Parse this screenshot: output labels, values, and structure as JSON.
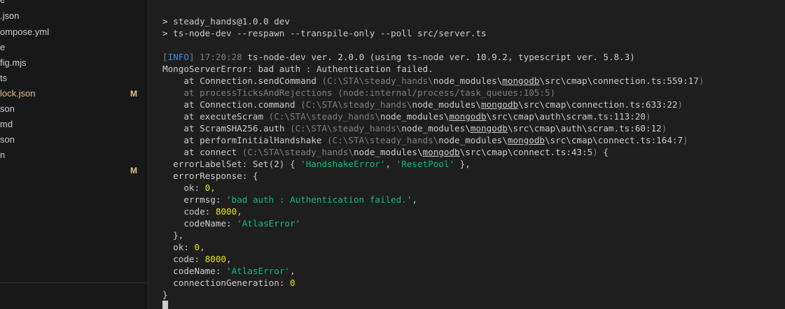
{
  "sidebar": {
    "files": [
      {
        "name": "e",
        "badge": ""
      },
      {
        "name": ".json",
        "badge": ""
      },
      {
        "name": "ompose.yml",
        "badge": ""
      },
      {
        "name": "e",
        "badge": ""
      },
      {
        "name": "fig.mjs",
        "badge": ""
      },
      {
        "name": "ts",
        "badge": ""
      },
      {
        "name": "lock.json",
        "badge": "M"
      },
      {
        "name": "son",
        "badge": ""
      },
      {
        "name": "md",
        "badge": ""
      },
      {
        "name": "son",
        "badge": ""
      },
      {
        "name": "n",
        "badge": ""
      },
      {
        "name": "",
        "badge": "M"
      }
    ]
  },
  "terminal": {
    "lines": [
      {
        "segments": [
          {
            "t": "> steady_hands@1.0.0 dev"
          }
        ]
      },
      {
        "segments": [
          {
            "t": "> ts-node-dev --respawn --transpile-only --poll src/server.ts"
          }
        ]
      },
      {
        "segments": []
      },
      {
        "segments": [
          {
            "t": "[",
            "c": "c-gray"
          },
          {
            "t": "INFO",
            "c": "c-cyan"
          },
          {
            "t": "] ",
            "c": "c-gray"
          },
          {
            "t": "17:20:28",
            "c": "c-gray"
          },
          {
            "t": " ts-node-dev ver. 2.0.0 (using ts-node ver. 10.9.2, typescript ver. 5.8.3)"
          }
        ]
      },
      {
        "segments": [
          {
            "t": "MongoServerError: bad auth : Authentication failed."
          }
        ]
      },
      {
        "segments": [
          {
            "t": "    at Connection.sendCommand "
          },
          {
            "t": "(C:\\STA\\steady_hands\\",
            "c": "c-gray"
          },
          {
            "t": "node_modules\\",
            "c": ""
          },
          {
            "t": "mongodb",
            "c": "c-uline"
          },
          {
            "t": "\\src\\cmap\\connection.ts:559:17",
            "c": ""
          },
          {
            "t": ")",
            "c": "c-gray"
          }
        ]
      },
      {
        "segments": [
          {
            "t": "    at processTicksAndRejections (node:internal/process/task_queues:105:5)",
            "c": "c-gray"
          }
        ]
      },
      {
        "segments": [
          {
            "t": "    at Connection.command "
          },
          {
            "t": "(C:\\STA\\steady_hands\\",
            "c": "c-gray"
          },
          {
            "t": "node_modules\\",
            "c": ""
          },
          {
            "t": "mongodb",
            "c": "c-uline"
          },
          {
            "t": "\\src\\cmap\\connection.ts:633:22",
            "c": ""
          },
          {
            "t": ")",
            "c": "c-gray"
          }
        ]
      },
      {
        "segments": [
          {
            "t": "    at executeScram "
          },
          {
            "t": "(C:\\STA\\steady_hands\\",
            "c": "c-gray"
          },
          {
            "t": "node_modules\\",
            "c": ""
          },
          {
            "t": "mongodb",
            "c": "c-uline"
          },
          {
            "t": "\\src\\cmap\\auth\\scram.ts:113:20",
            "c": ""
          },
          {
            "t": ")",
            "c": "c-gray"
          }
        ]
      },
      {
        "segments": [
          {
            "t": "    at ScramSHA256.auth "
          },
          {
            "t": "(C:\\STA\\steady_hands\\",
            "c": "c-gray"
          },
          {
            "t": "node_modules\\",
            "c": ""
          },
          {
            "t": "mongodb",
            "c": "c-uline"
          },
          {
            "t": "\\src\\cmap\\auth\\scram.ts:60:12",
            "c": ""
          },
          {
            "t": ")",
            "c": "c-gray"
          }
        ]
      },
      {
        "segments": [
          {
            "t": "    at performInitialHandshake "
          },
          {
            "t": "(C:\\STA\\steady_hands\\",
            "c": "c-gray"
          },
          {
            "t": "node_modules\\",
            "c": ""
          },
          {
            "t": "mongodb",
            "c": "c-uline"
          },
          {
            "t": "\\src\\cmap\\connect.ts:164:7",
            "c": ""
          },
          {
            "t": ")",
            "c": "c-gray"
          }
        ]
      },
      {
        "segments": [
          {
            "t": "    at connect "
          },
          {
            "t": "(C:\\STA\\steady_hands\\",
            "c": "c-gray"
          },
          {
            "t": "node_modules\\",
            "c": ""
          },
          {
            "t": "mongodb",
            "c": "c-uline"
          },
          {
            "t": "\\src\\cmap\\connect.ts:43:5",
            "c": ""
          },
          {
            "t": ")",
            "c": "c-gray"
          },
          {
            "t": " {"
          }
        ]
      },
      {
        "segments": [
          {
            "t": "  errorLabelSet: Set(2) { "
          },
          {
            "t": "'HandshakeError'",
            "c": "c-green"
          },
          {
            "t": ", "
          },
          {
            "t": "'ResetPool'",
            "c": "c-green"
          },
          {
            "t": " },"
          }
        ]
      },
      {
        "segments": [
          {
            "t": "  errorResponse: {"
          }
        ]
      },
      {
        "segments": [
          {
            "t": "    ok: "
          },
          {
            "t": "0",
            "c": "c-yellow"
          },
          {
            "t": ","
          }
        ]
      },
      {
        "segments": [
          {
            "t": "    errmsg: "
          },
          {
            "t": "'bad auth : Authentication failed.'",
            "c": "c-green"
          },
          {
            "t": ","
          }
        ]
      },
      {
        "segments": [
          {
            "t": "    code: "
          },
          {
            "t": "8000",
            "c": "c-yellow"
          },
          {
            "t": ","
          }
        ]
      },
      {
        "segments": [
          {
            "t": "    codeName: "
          },
          {
            "t": "'AtlasError'",
            "c": "c-green"
          }
        ]
      },
      {
        "segments": [
          {
            "t": "  },"
          }
        ]
      },
      {
        "segments": [
          {
            "t": "  ok: "
          },
          {
            "t": "0",
            "c": "c-yellow"
          },
          {
            "t": ","
          }
        ]
      },
      {
        "segments": [
          {
            "t": "  code: "
          },
          {
            "t": "8000",
            "c": "c-yellow"
          },
          {
            "t": ","
          }
        ]
      },
      {
        "segments": [
          {
            "t": "  codeName: "
          },
          {
            "t": "'AtlasError'",
            "c": "c-green"
          },
          {
            "t": ","
          }
        ]
      },
      {
        "segments": [
          {
            "t": "  connectionGeneration: "
          },
          {
            "t": "0",
            "c": "c-yellow"
          }
        ]
      },
      {
        "segments": [
          {
            "t": "}"
          }
        ]
      }
    ]
  }
}
